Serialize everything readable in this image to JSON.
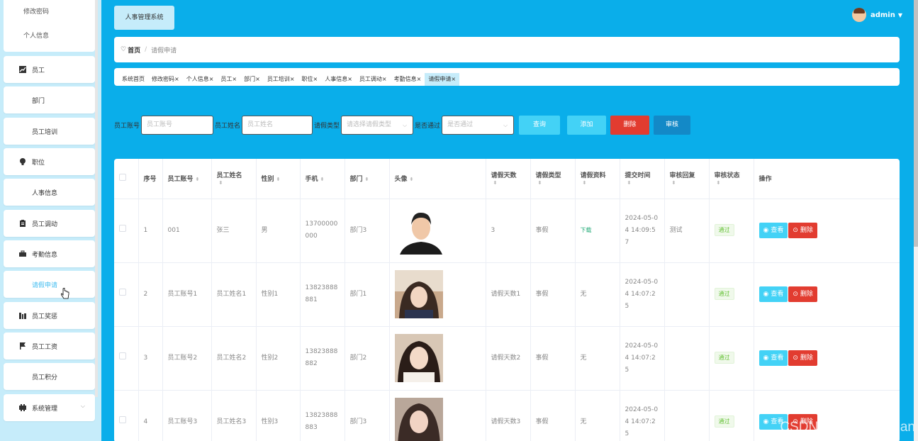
{
  "sidebar": {
    "sub_items": [
      {
        "label": "修改密码"
      },
      {
        "label": "个人信息"
      }
    ],
    "items": [
      {
        "label": "员工",
        "icon": "chart-icon"
      },
      {
        "label": "部门",
        "icon": "grid-icon"
      },
      {
        "label": "员工培训",
        "icon": "grid-icon"
      },
      {
        "label": "职位",
        "icon": "bulb-icon"
      },
      {
        "label": "人事信息",
        "icon": "grid-icon"
      },
      {
        "label": "员工调动",
        "icon": "clipboard-icon"
      },
      {
        "label": "考勤信息",
        "icon": "briefcase-icon"
      },
      {
        "label": "请假申请",
        "icon": "grid-icon",
        "active": true
      },
      {
        "label": "员工奖惩",
        "icon": "books-icon"
      },
      {
        "label": "员工工资",
        "icon": "flag-icon"
      },
      {
        "label": "员工积分",
        "icon": "grid-icon"
      },
      {
        "label": "系统管理",
        "icon": "settings-icon"
      }
    ]
  },
  "header": {
    "brand": "人事管理系统",
    "user": "admin"
  },
  "breadcrumb": {
    "home": "首页",
    "sep": "/",
    "current": "请假申请"
  },
  "tags": [
    "系统首页",
    "修改密码",
    "个人信息",
    "员工",
    "部门",
    "员工培训",
    "职位",
    "人事信息",
    "员工调动",
    "考勤信息",
    "请假申请"
  ],
  "filters": {
    "account_label": "员工账号",
    "account_placeholder": "员工账号",
    "name_label": "员工姓名",
    "name_placeholder": "员工姓名",
    "type_label": "请假类型",
    "type_placeholder": "请选择请假类型",
    "pass_label": "是否通过",
    "pass_placeholder": "是否通过",
    "query": "查询",
    "add": "添加",
    "delete": "删除",
    "review": "审核"
  },
  "colors": {
    "primary": "#0aaeea",
    "light": "#c6ecfa",
    "info": "#43d2f6",
    "danger": "#e23c30",
    "review": "#1389c7"
  },
  "table": {
    "headers": [
      "",
      "序号",
      "员工账号",
      "员工姓名",
      "性别",
      "手机",
      "部门",
      "头像",
      "请假天数",
      "请假类型",
      "请假资料",
      "提交时间",
      "审核回复",
      "审核状态",
      "操作"
    ],
    "rows": [
      {
        "no": "1",
        "account": "001",
        "name": "张三",
        "gender": "男",
        "phone": "13700000000",
        "dept": "部门3",
        "days": "3",
        "type": "事假",
        "file": "下载",
        "time": "2024-05-04 14:09:57",
        "reply": "测试",
        "status": "通过"
      },
      {
        "no": "2",
        "account": "员工账号1",
        "name": "员工姓名1",
        "gender": "性别1",
        "phone": "13823888881",
        "dept": "部门1",
        "days": "请假天数1",
        "type": "事假",
        "file": "无",
        "time": "2024-05-04 14:07:25",
        "reply": "",
        "status": "通过"
      },
      {
        "no": "3",
        "account": "员工账号2",
        "name": "员工姓名2",
        "gender": "性别2",
        "phone": "13823888882",
        "dept": "部门2",
        "days": "请假天数2",
        "type": "事假",
        "file": "无",
        "time": "2024-05-04 14:07:25",
        "reply": "",
        "status": "通过"
      },
      {
        "no": "4",
        "account": "员工账号3",
        "name": "员工姓名3",
        "gender": "性别3",
        "phone": "13823888883",
        "dept": "部门3",
        "days": "请假天数3",
        "type": "事假",
        "file": "无",
        "time": "2024-05-04 14:07:25",
        "reply": "",
        "status": "通过"
      }
    ],
    "view_label": "查看",
    "delete_label": "删除"
  },
  "watermark": "CSDN @计算机YiDian"
}
